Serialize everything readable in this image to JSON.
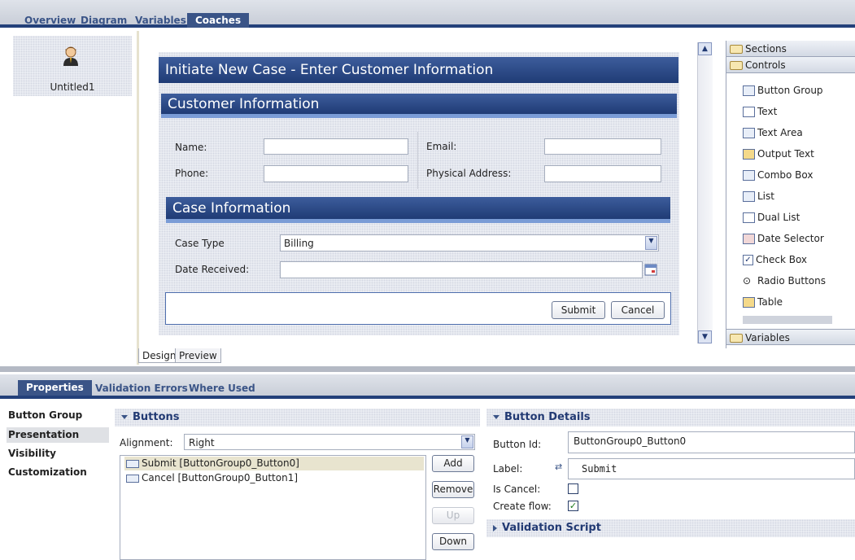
{
  "top_tabs": [
    "Overview",
    "Diagram",
    "Variables",
    "Coaches"
  ],
  "coach_thumb": {
    "label": "Untitled1"
  },
  "coach": {
    "title": "Initiate New Case -  Enter Customer Information",
    "customer_section": "Customer Information",
    "name_label": "Name:",
    "email_label": "Email:",
    "phone_label": "Phone:",
    "address_label": "Physical Address:",
    "case_section": "Case Information",
    "case_type_label": "Case Type",
    "case_type_value": "Billing",
    "date_label": "Date Received:",
    "submit": "Submit",
    "cancel": "Cancel"
  },
  "palette": {
    "sections": "Sections",
    "controls": "Controls",
    "items": [
      "Button Group",
      "Text",
      "Text Area",
      "Output Text",
      "Combo Box",
      "List",
      "Dual List",
      "Date Selector",
      "Check Box",
      "Radio Buttons",
      "Table"
    ],
    "variables": "Variables"
  },
  "design_tabs": [
    "Design",
    "Preview"
  ],
  "prop_tabs": [
    "Properties",
    "Validation Errors",
    "Where Used"
  ],
  "side_nav": [
    "Button Group",
    "Presentation",
    "Visibility",
    "Customization"
  ],
  "buttons_panel": {
    "title": "Buttons",
    "alignment_label": "Alignment:",
    "alignment_value": "Right",
    "list": [
      "Submit [ButtonGroup0_Button0]",
      "Cancel [ButtonGroup0_Button1]"
    ],
    "add": "Add",
    "remove": "Remove",
    "up": "Up",
    "down": "Down"
  },
  "details_panel": {
    "title": "Button Details",
    "id_label": "Button Id:",
    "id_value": "ButtonGroup0_Button0",
    "label_label": "Label:",
    "label_value": "Submit",
    "is_cancel_label": "Is Cancel:",
    "create_flow_label": "Create flow:",
    "validation_script": "Validation Script"
  }
}
